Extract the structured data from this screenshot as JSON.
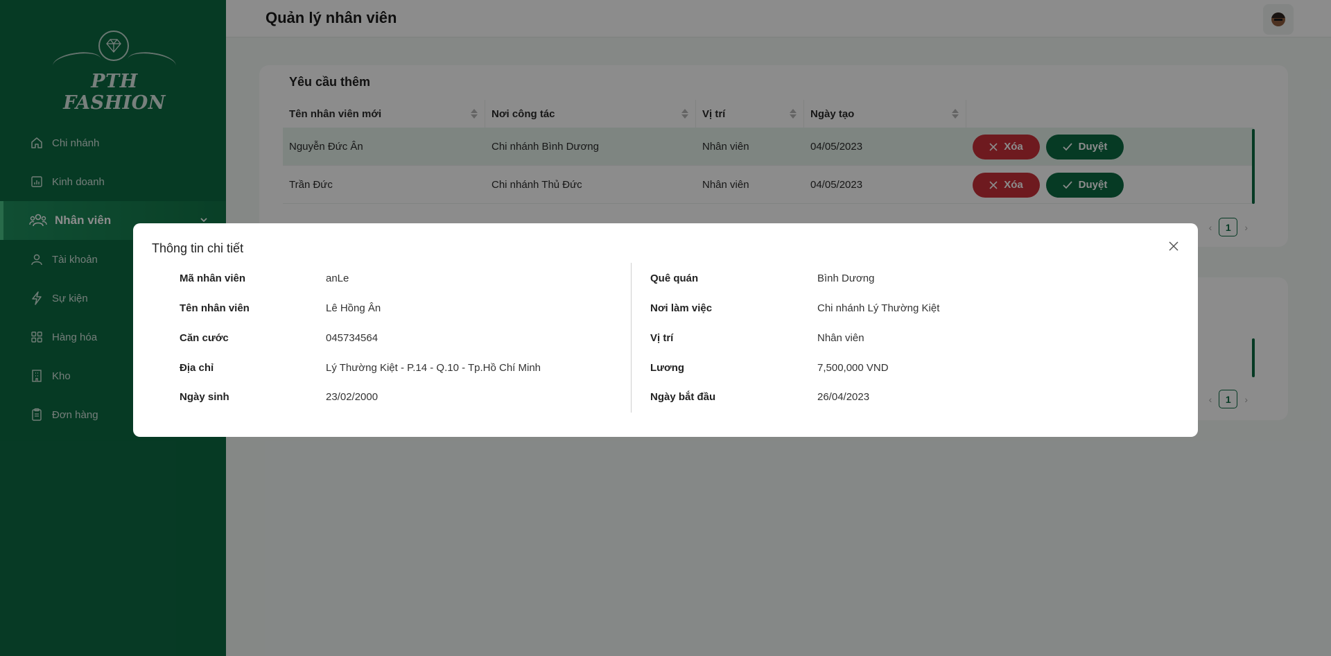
{
  "sidebar": {
    "brand": "PTH FASHION",
    "items": [
      {
        "label": "Chi nhánh"
      },
      {
        "label": "Kinh doanh"
      },
      {
        "label": "Nhân viên"
      },
      {
        "label": "Tài khoản"
      },
      {
        "label": "Sự kiện"
      },
      {
        "label": "Hàng hóa"
      },
      {
        "label": "Kho"
      },
      {
        "label": "Đơn hàng"
      }
    ]
  },
  "header": {
    "title": "Quản lý nhân viên"
  },
  "requests": {
    "title": "Yêu cầu thêm",
    "columns": [
      "Tên nhân viên mới",
      "Nơi công tác",
      "Vị trí",
      "Ngày tạo"
    ],
    "rows": [
      {
        "name": "Nguyễn Đức Ân",
        "workplace": "Chi nhánh Bình Dương",
        "position": "Nhân viên",
        "created": "04/05/2023"
      },
      {
        "name": "Trần Đức",
        "workplace": "Chi nhánh Thủ Đức",
        "position": "Nhân viên",
        "created": "04/05/2023"
      }
    ],
    "delete_label": "Xóa",
    "approve_label": "Duyệt",
    "page": "1"
  },
  "second_table": {
    "page": "1"
  },
  "modal": {
    "title": "Thông tin chi tiết",
    "left": [
      {
        "label": "Mã nhân viên",
        "value": "anLe"
      },
      {
        "label": "Tên nhân viên",
        "value": "Lê Hồng Ân"
      },
      {
        "label": "Căn cước",
        "value": "045734564"
      },
      {
        "label": "Địa chỉ",
        "value": "Lý Thường Kiệt - P.14 - Q.10 - Tp.Hồ Chí Minh"
      },
      {
        "label": "Ngày sinh",
        "value": "23/02/2000"
      }
    ],
    "right": [
      {
        "label": "Quê quán",
        "value": "Bình Dương"
      },
      {
        "label": "Nơi làm việc",
        "value": "Chi nhánh Lý Thường Kiệt"
      },
      {
        "label": "Vị trí",
        "value": "Nhân viên"
      },
      {
        "label": "Lương",
        "value": "7,500,000 VND"
      },
      {
        "label": "Ngày bắt đầu",
        "value": "26/04/2023"
      }
    ]
  },
  "colors": {
    "sidebar": "#0c6a43",
    "danger": "#c8313a",
    "primary": "#0c6a43"
  }
}
